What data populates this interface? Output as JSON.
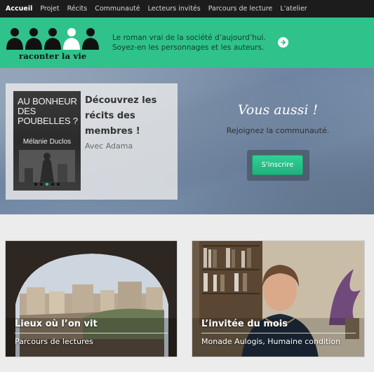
{
  "nav": {
    "items": [
      {
        "label": "Accueil",
        "active": true
      },
      {
        "label": "Projet"
      },
      {
        "label": "Récits"
      },
      {
        "label": "Communauté"
      },
      {
        "label": "Lecteurs invités"
      },
      {
        "label": "Parcours de lecture"
      },
      {
        "label": "L'atelier"
      }
    ]
  },
  "banner": {
    "logo_text": "raconter la vie",
    "tagline_line1": "Le roman vrai de la société d’aujourd’hui.",
    "tagline_line2": "Soyez-en les personnages et les auteurs.",
    "arrow_icon": "arrow-right-circle-icon",
    "color": "#2fc28b"
  },
  "hero": {
    "feature": {
      "book_title": "AU BONHEUR DES POUBELLES ?",
      "book_author": "Mélanie Duclos",
      "heading": "Découvrez les récits des membres !",
      "subtext": "Avec Adama"
    },
    "cta": {
      "title": "Vous aussi !",
      "subtitle": "Rejoignez la communauté.",
      "button_label": "S'inscrire",
      "button_color": "#2fc28b"
    }
  },
  "tiles": [
    {
      "title": "Lieux où l’on vit",
      "subtitle": "Parcours de lectures"
    },
    {
      "title": "L’invitée du mois",
      "subtitle": "Monade Aulogis, Humaine condition"
    }
  ]
}
